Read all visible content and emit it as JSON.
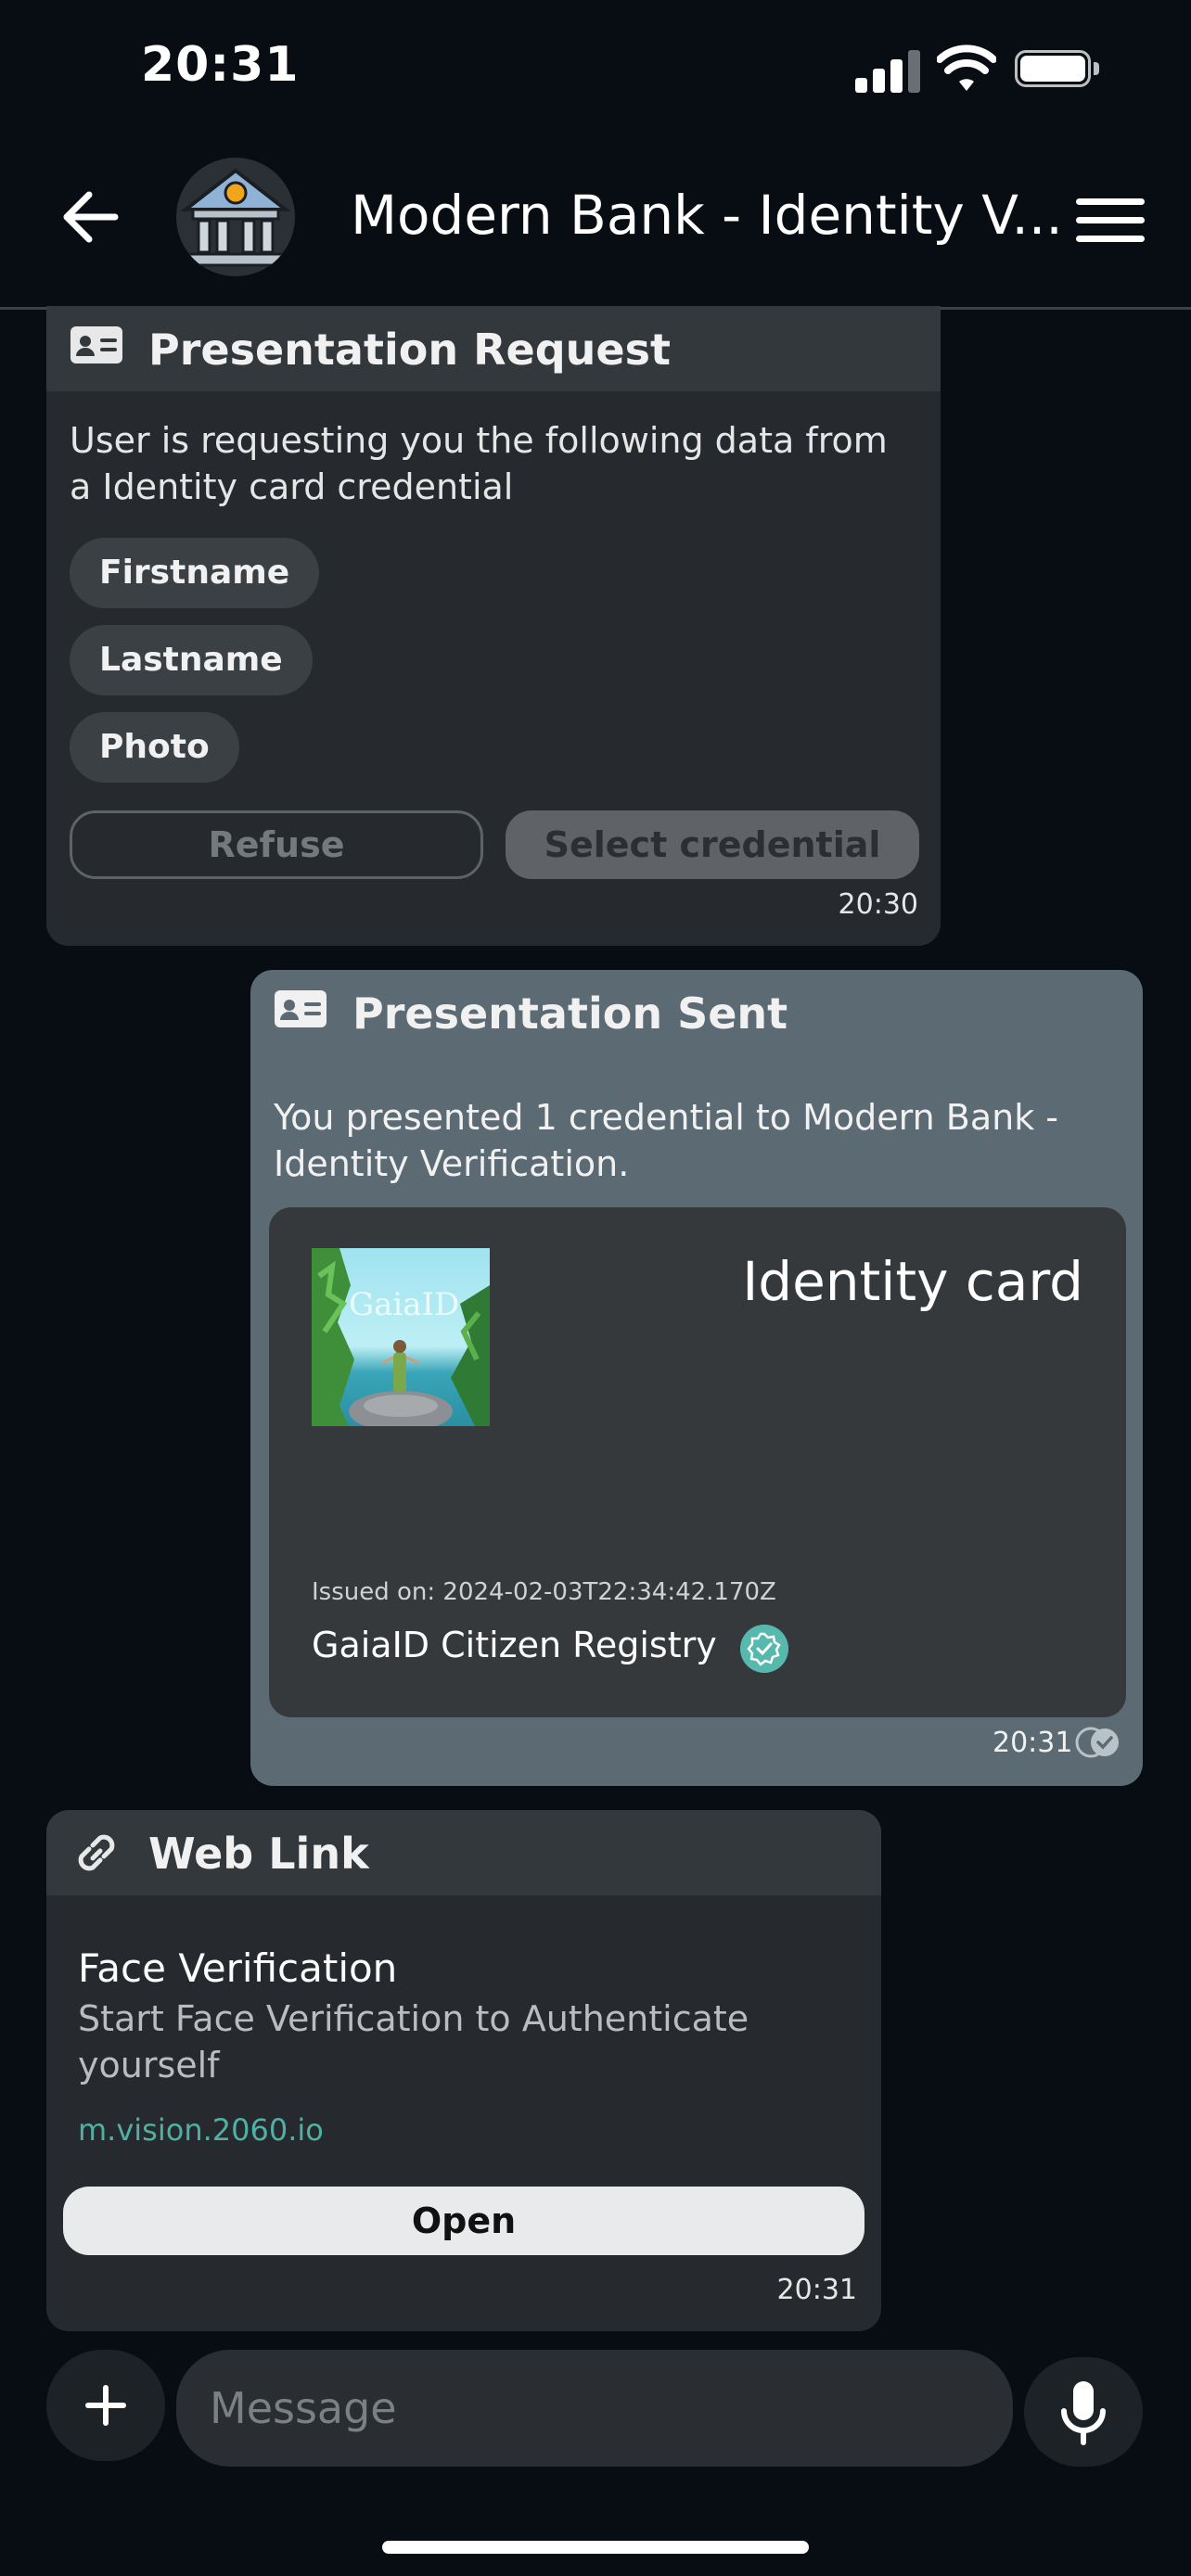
{
  "status_bar": {
    "time": "20:31"
  },
  "header": {
    "title": "Modern Bank - Identity V..."
  },
  "presentation_request": {
    "heading": "Presentation Request",
    "text": "User is requesting you the following data from a Identity card credential",
    "fields": [
      "Firstname",
      "Lastname",
      "Photo"
    ],
    "refuse_label": "Refuse",
    "select_label": "Select credential",
    "time": "20:30"
  },
  "presentation_sent": {
    "heading": "Presentation Sent",
    "text": "You presented 1 credential to Modern Bank - Identity Verification.",
    "credential": {
      "image_text": "GaiaID",
      "title": "Identity card",
      "issued": "Issued on: 2024-02-03T22:34:42.170Z",
      "issuer": "GaiaID Citizen Registry"
    },
    "time": "20:31"
  },
  "web_link": {
    "heading": "Web Link",
    "title": "Face Verification",
    "description": "Start Face Verification to Authenticate yourself",
    "url": "m.vision.2060.io",
    "open_label": "Open",
    "time": "20:31"
  },
  "composer": {
    "placeholder": "Message"
  },
  "colors": {
    "background": "#070d12",
    "card": "#262a2e",
    "sent_bubble": "#5c6a74",
    "link": "#4fb0a3",
    "verified": "#57b8ad"
  }
}
